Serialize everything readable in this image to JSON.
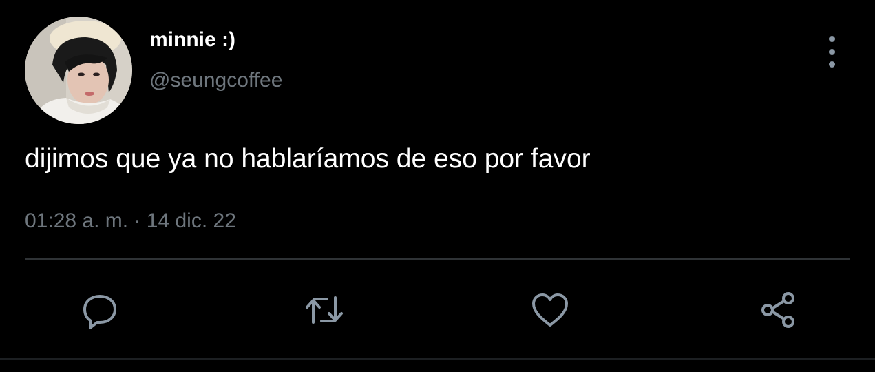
{
  "user": {
    "display_name": "minnie :)",
    "handle": "@seungcoffee",
    "avatar": "profile-photo"
  },
  "tweet": {
    "text": "dijimos que ya no hablaríamos de eso por favor",
    "time": "01:28 a. m.",
    "separator": "·",
    "date": "14 dic. 22"
  },
  "menu": {
    "icon": "more-vertical-icon"
  },
  "actions": [
    {
      "name": "reply",
      "icon": "speech-bubble-icon"
    },
    {
      "name": "retweet",
      "icon": "retweet-arrows-icon"
    },
    {
      "name": "like",
      "icon": "heart-icon"
    },
    {
      "name": "share",
      "icon": "share-nodes-icon"
    }
  ],
  "colors": {
    "background": "#000000",
    "primary_text": "#ffffff",
    "secondary_text": "#6e767d",
    "icon": "#8b98a5",
    "divider": "#2f3336"
  }
}
